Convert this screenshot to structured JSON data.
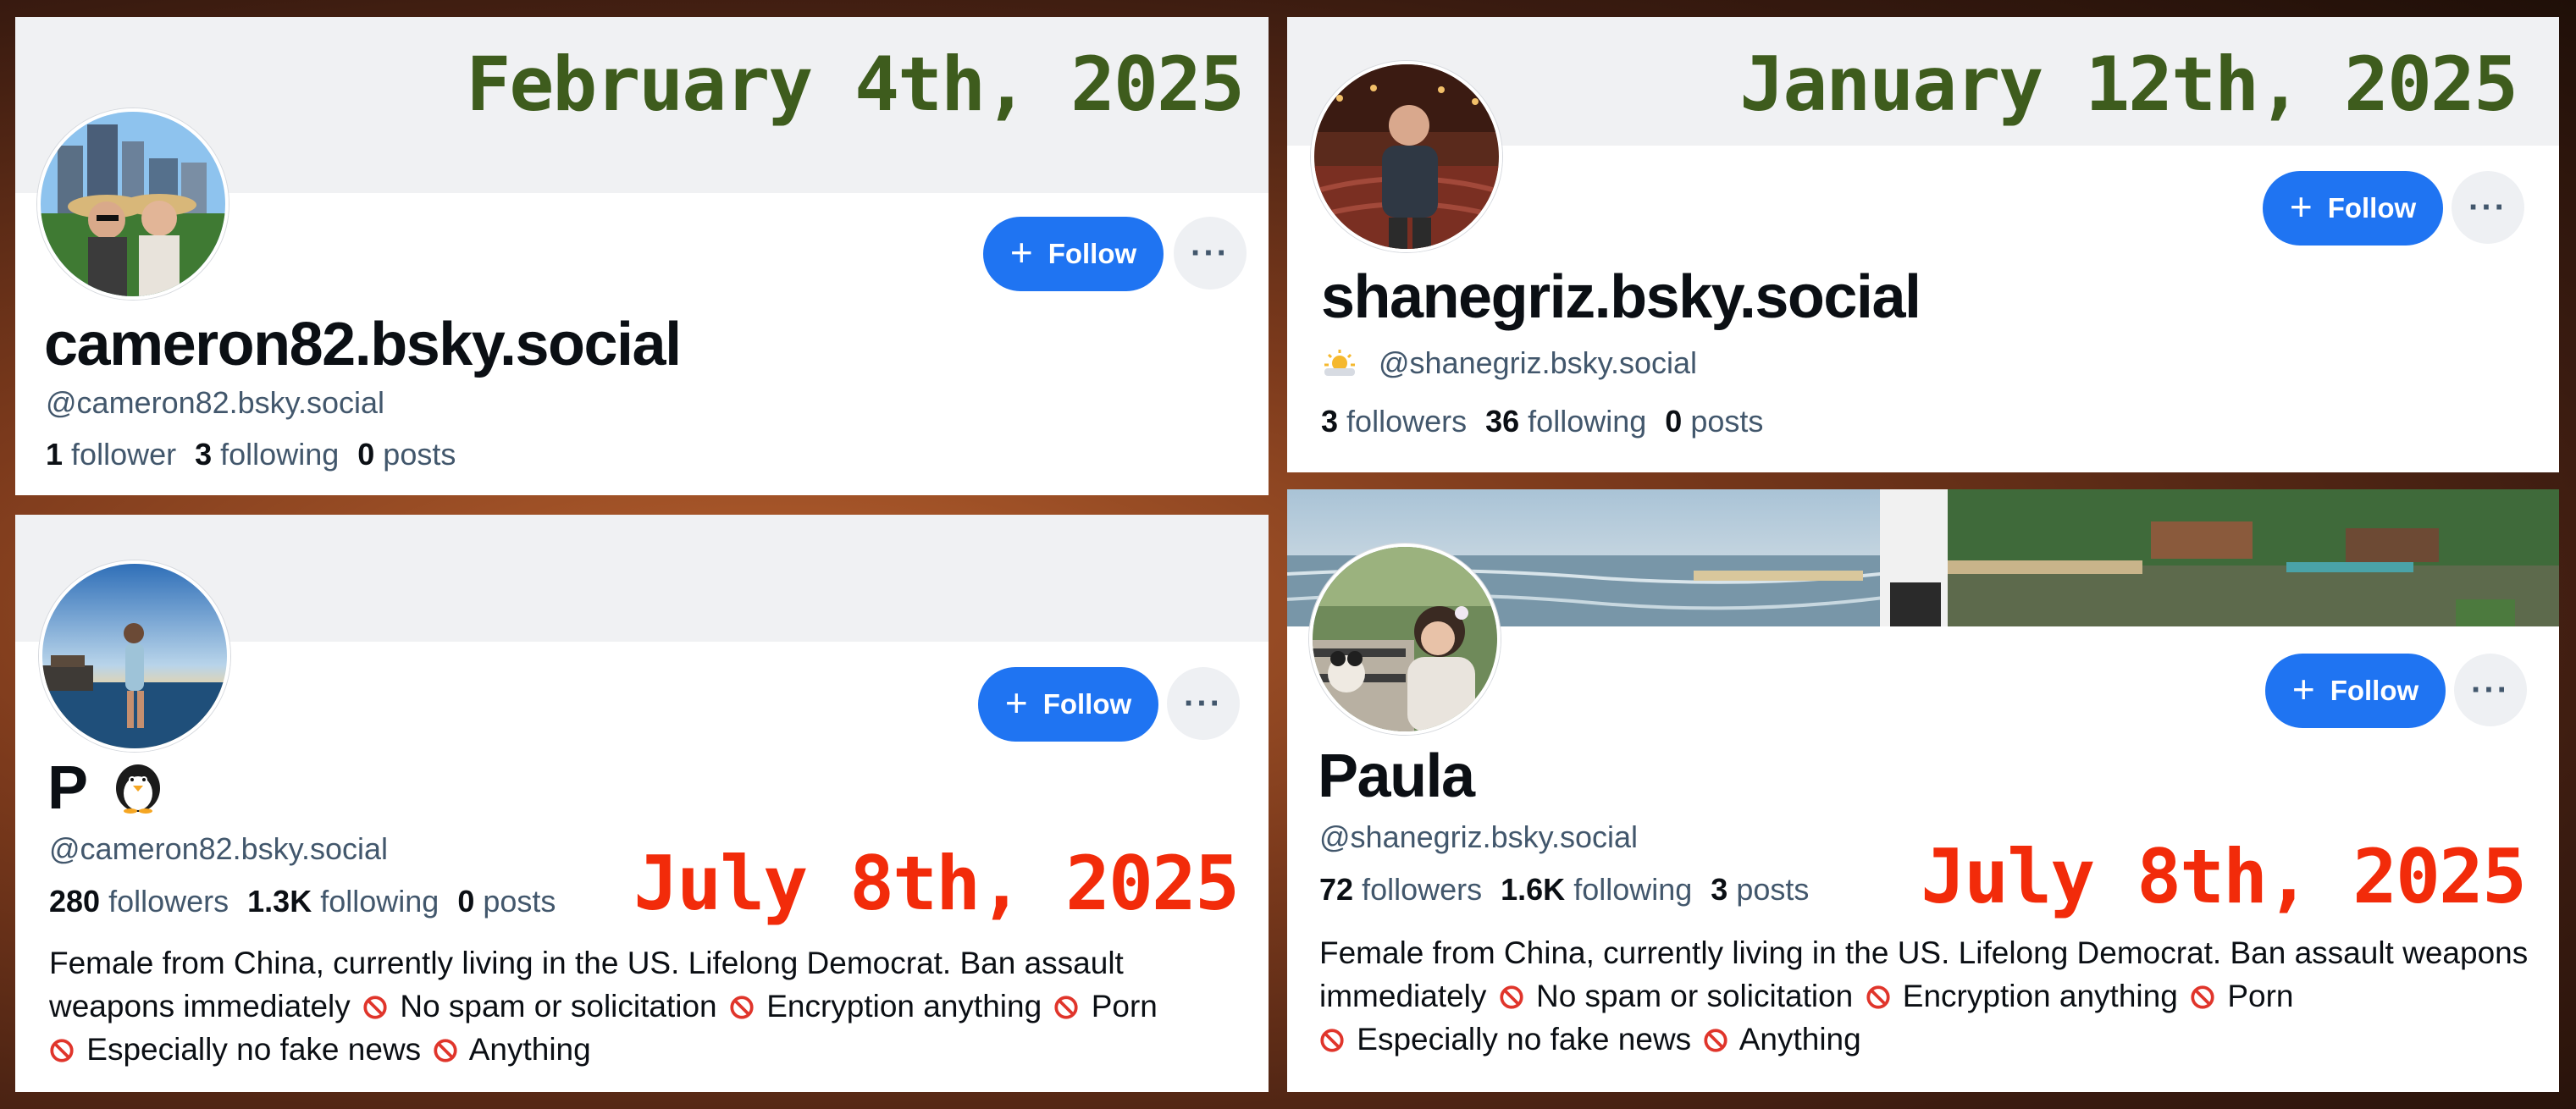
{
  "panel_tl": {
    "date": "February 4th, 2025",
    "display_name": "cameron82.bsky.social",
    "handle": "@cameron82.bsky.social",
    "followers_count": "1",
    "followers_label": "follower",
    "following_count": "3",
    "following_label": "following",
    "posts_count": "0",
    "posts_label": "posts",
    "follow_label": "Follow",
    "more_label": "···"
  },
  "panel_tr": {
    "date": "January 12th, 2025",
    "display_name": "shanegriz.bsky.social",
    "handle": "@shanegriz.bsky.social",
    "followers_count": "3",
    "followers_label": "followers",
    "following_count": "36",
    "following_label": "following",
    "posts_count": "0",
    "posts_label": "posts",
    "follow_label": "Follow",
    "more_label": "···"
  },
  "panel_bl": {
    "date": "July 8th, 2025",
    "display_name": "P",
    "handle": "@cameron82.bsky.social",
    "followers_count": "280",
    "followers_label": "followers",
    "following_count": "1.3K",
    "following_label": "following",
    "posts_count": "0",
    "posts_label": "posts",
    "follow_label": "Follow",
    "more_label": "···",
    "bio": {
      "part1": "Female from China, currently living in the US. Lifelong Democrat. Ban assault weapons immediately",
      "part2": "No spam or solicitation",
      "part3": "Encryption anything",
      "part4": "Porn",
      "part5": "Especially no fake news",
      "part6": "Anything"
    }
  },
  "panel_br": {
    "date": "July 8th, 2025",
    "display_name": "Paula",
    "handle": "@shanegriz.bsky.social",
    "followers_count": "72",
    "followers_label": "followers",
    "following_count": "1.6K",
    "following_label": "following",
    "posts_count": "3",
    "posts_label": "posts",
    "follow_label": "Follow",
    "more_label": "···",
    "bio": {
      "part1": "Female from China, currently living in the US. Lifelong Democrat. Ban assault weapons immediately",
      "part2": "No spam or solicitation",
      "part3": "Encryption anything",
      "part4": "Porn",
      "part5": "Especially no fake news",
      "part6": "Anything"
    }
  },
  "colors": {
    "follow_button": "#1f74f2",
    "date_old": "#3e5c1d",
    "date_new": "#f22b0a",
    "handle_text": "#42576c"
  },
  "icons": [
    "plus-icon",
    "ellipsis-icon",
    "no-entry-icon",
    "penguin-emoji",
    "sun-cloud-emoji"
  ]
}
